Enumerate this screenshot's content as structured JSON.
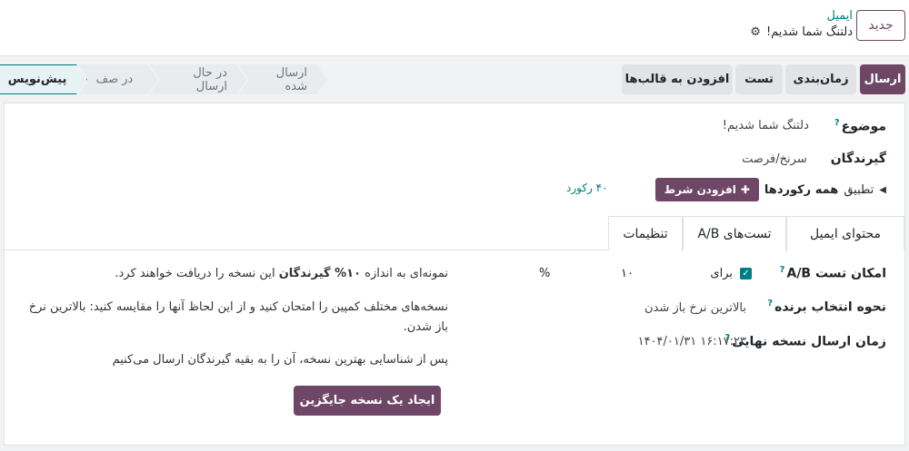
{
  "header": {
    "new_button": "جدید",
    "breadcrumb_parent": "ایمیل",
    "breadcrumb_current": "دلتنگ شما شدیم!"
  },
  "toolbar": {
    "send": "ارسال",
    "schedule": "زمان‌بندی",
    "test": "تست",
    "add_to_templates": "افزودن به قالب‌ها"
  },
  "status_stages": [
    {
      "label": "پیش‌نویس",
      "active": true
    },
    {
      "label": "در صف",
      "active": false
    },
    {
      "label": "در حال ارسال",
      "active": false
    },
    {
      "label": "ارسال شده",
      "active": false
    }
  ],
  "form": {
    "subject_label": "موضوع",
    "subject_value": "دلتنگ شما شدیم!",
    "recipients_label": "گیرندگان",
    "recipients_value": "سرنخ/فرصت",
    "filter_apply": "تطبیق",
    "filter_all": "همه رکوردها",
    "add_condition": "افزودن شرط",
    "records_count": "۴۰ رکورد"
  },
  "tabs": [
    {
      "label": "محتوای ایمیل",
      "active": false
    },
    {
      "label": "تست‌های A/B",
      "active": true
    },
    {
      "label": "تنظیمات",
      "active": false
    }
  ],
  "ab": {
    "allow_label": "امکان تست A/B",
    "allow_checked": true,
    "for_label": "برای",
    "percent_value": "۱۰",
    "percent_sign": "%",
    "winner_label": "نحوه انتخاب برنده",
    "winner_value": "بالاترین نرخ باز شدن",
    "final_send_label": "زمان ارسال نسخه نهایی",
    "final_send_value": "۱۴۰۴/۰۱/۳۱ ۱۶:۱۷:۲۳",
    "note_1_pre": "نمونه‌ای به اندازه",
    "note_1_bold": "۱۰% گیرندگان",
    "note_1_post": "این نسخه را دریافت خواهند کرد.",
    "note_2": "نسخه‌های مختلف کمپین را امتحان کنید و از این لحاظ آنها را مقایسه کنید: بالاترین نرخ باز شدن.",
    "note_3": "پس از شناسایی بهترین نسخه، آن را به بقیه گیرندگان ارسال می‌کنیم",
    "create_alt_button": "ایجاد یک نسخه جایگزین"
  },
  "icons": {
    "gear": "gear-icon",
    "plus": "plus-icon",
    "check": "check-icon",
    "help": "question-icon",
    "caret": "caret-left-icon"
  },
  "colors": {
    "brand": "#6f4766",
    "accent": "#017e84"
  }
}
